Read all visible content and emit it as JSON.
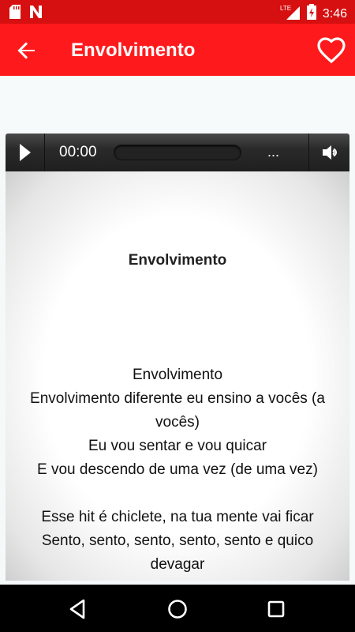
{
  "status_bar": {
    "time": "3:46",
    "network_label": "LTE",
    "icons": [
      "sd-card-icon",
      "n-notification-icon",
      "lte-signal-icon",
      "battery-charging-icon"
    ]
  },
  "app_bar": {
    "title": "Envolvimento",
    "back_icon": "arrow-back-icon",
    "favorite_icon": "heart-outline-icon"
  },
  "player": {
    "current_time": "00:00",
    "duration": "...",
    "progress": 0,
    "play_icon": "play-icon",
    "volume_icon": "volume-icon"
  },
  "lyrics": {
    "heading": "Envolvimento",
    "lines": [
      "Envolvimento",
      "Envolvimento diferente eu ensino a vocês (a vocês)",
      "Eu vou sentar e vou quicar",
      "E vou descendo de uma vez (de uma vez)",
      "",
      "Esse hit é chiclete, na tua mente vai ficar",
      "Sento, sento, sento, sento, sento e quico devagar"
    ]
  },
  "nav_bar": {
    "icons": [
      "back-triangle-icon",
      "home-circle-icon",
      "recents-square-icon"
    ]
  },
  "colors": {
    "status_bar": "#d60f10",
    "app_bar": "#fe1a1c",
    "player": "#2a2a2a"
  }
}
